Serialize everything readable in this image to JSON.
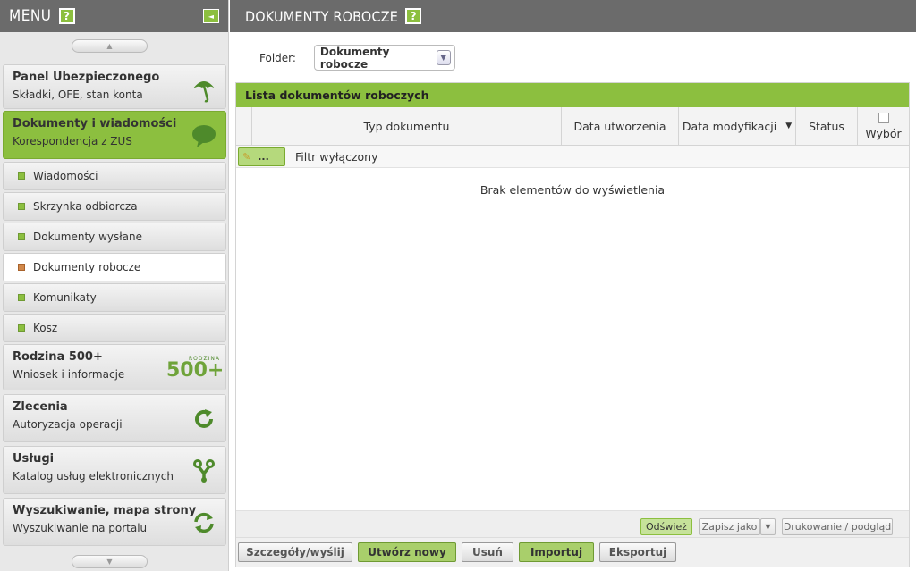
{
  "sidebar": {
    "title": "MENU",
    "help": "?",
    "collapse": "◄",
    "scroll_up": "▲",
    "scroll_down": "▼",
    "groups": [
      {
        "title": "Panel Ubezpieczonego",
        "subtitle": "Składki, OFE, stan konta",
        "icon": "umbrella-icon"
      },
      {
        "title": "Dokumenty i wiadomości",
        "subtitle": "Korespondencja z ZUS",
        "icon": "speech-bubble-icon"
      },
      {
        "title": "Rodzina 500+",
        "subtitle": "Wniosek i informacje",
        "icon": "rodzina-500-logo",
        "logo_top": "RODZINA",
        "logo_main": "500+"
      },
      {
        "title": "Zlecenia",
        "subtitle": "Autoryzacja operacji",
        "icon": "refresh-icon"
      },
      {
        "title": "Usługi",
        "subtitle": "Katalog usług elektronicznych",
        "icon": "services-icon"
      },
      {
        "title": "Wyszukiwanie, mapa strony",
        "subtitle": "Wyszukiwanie na portalu",
        "icon": "sync-icon"
      }
    ],
    "sub_items": [
      {
        "label": "Wiadomości"
      },
      {
        "label": "Skrzynka odbiorcza"
      },
      {
        "label": "Dokumenty wysłane"
      },
      {
        "label": "Dokumenty robocze"
      },
      {
        "label": "Komunikaty"
      },
      {
        "label": "Kosz"
      }
    ]
  },
  "main": {
    "title": "DOKUMENTY ROBOCZE",
    "help": "?",
    "folder_label": "Folder:",
    "folder_value": "Dokumenty robocze",
    "list_title": "Lista dokumentów roboczych",
    "columns": [
      "Typ dokumentu",
      "Data utworzenia",
      "Data modyfikacji",
      "Status",
      "Wybór"
    ],
    "filter_button": "...",
    "filter_text": "Filtr wyłączony",
    "empty": "Brak elementów do wyświetlenia",
    "refresh": "Odśwież",
    "save_as": "Zapisz jako",
    "print": "Drukowanie / podgląd",
    "actions": [
      "Szczegóły/wyślij",
      "Utwórz nowy",
      "Usuń",
      "Importuj",
      "Eksportuj"
    ]
  }
}
